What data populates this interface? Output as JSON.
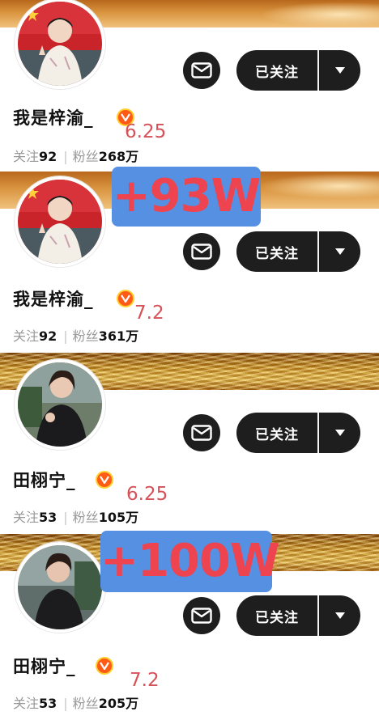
{
  "cards": [
    {
      "name": "我是梓渝_",
      "following_label": "关注",
      "following_count": "92",
      "fans_label": "粉丝",
      "fans_count": "268万",
      "follow_button": "已关注",
      "date_annotation": "6.25"
    },
    {
      "name": "我是梓渝_",
      "following_label": "关注",
      "following_count": "92",
      "fans_label": "粉丝",
      "fans_count": "361万",
      "follow_button": "已关注",
      "date_annotation": "7.2"
    },
    {
      "name": "田栩宁_",
      "following_label": "关注",
      "following_count": "53",
      "fans_label": "粉丝",
      "fans_count": "105万",
      "follow_button": "已关注",
      "date_annotation": "6.25"
    },
    {
      "name": "田栩宁_",
      "following_label": "关注",
      "following_count": "53",
      "fans_label": "粉丝",
      "fans_count": "205万",
      "follow_button": "已关注",
      "date_annotation": "7.2"
    }
  ],
  "overlays": [
    "+93W",
    "+100W"
  ],
  "stats_separator": "|",
  "icons": {
    "message": "envelope-icon",
    "dropdown": "caret-down-icon",
    "verified": "verified-v-icon"
  },
  "colors": {
    "button_bg": "#1e1e1e",
    "overlay_bg": "#5590e3",
    "overlay_text": "#ee4450",
    "date_text": "#d65259",
    "verified_badge": "#ff5a16"
  }
}
